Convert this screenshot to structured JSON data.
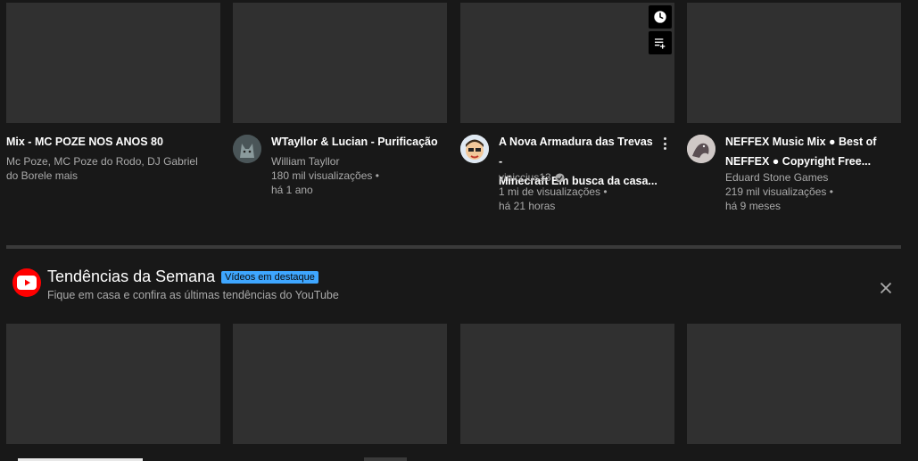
{
  "row1": [
    {
      "title_lines": [
        "Mix - MC POZE NOS ANOS 80"
      ],
      "meta_lines": [
        "Mc Poze, MC Poze do Rodo, DJ Gabriel",
        "do Borele mais"
      ],
      "has_avatar": false
    },
    {
      "title_lines": [
        "WTayllor & Lucian - Purificação"
      ],
      "meta_lines": [
        "William Tayllor",
        "180 mil visualizações •",
        "há 1 ano"
      ],
      "avatar_icon": "wolf-avatar-icon"
    },
    {
      "title_lines": [
        "A Nova Armadura das Trevas -",
        "Minecraft Em busca da casa..."
      ],
      "channel": "viniccius13",
      "verified_icon": "verified-check-icon",
      "meta_lines": [
        "1 mi de visualizações •",
        "há 21 horas"
      ],
      "avatar_icon": "cartoon-face-avatar-icon"
    },
    {
      "title_lines": [
        "NEFFEX Music Mix ● Best of",
        "NEFFEX ● Copyright Free..."
      ],
      "meta_lines": [
        "Eduard Stone Games",
        "219 mil visualizações •",
        "há 9 meses"
      ],
      "avatar_icon": "bird-avatar-icon"
    }
  ],
  "thumb_actions": {
    "watch_later_icon": "clock-icon",
    "add_queue_icon": "add-to-queue-icon",
    "more_icon": "more-vert-icon"
  },
  "section": {
    "title": "Tendências da Semana",
    "badge": "Vídeos em destaque",
    "subtitle": "Fique em casa e confira as últimas tendências do YouTube",
    "logo_icon": "youtube-logo-icon",
    "close_icon": "close-icon"
  },
  "colors": {
    "background": "#181818",
    "thumbnail": "#303030",
    "badge": "#3ea6ff",
    "logo_red": "#ff0000",
    "meta_text": "#aaaaaa"
  }
}
